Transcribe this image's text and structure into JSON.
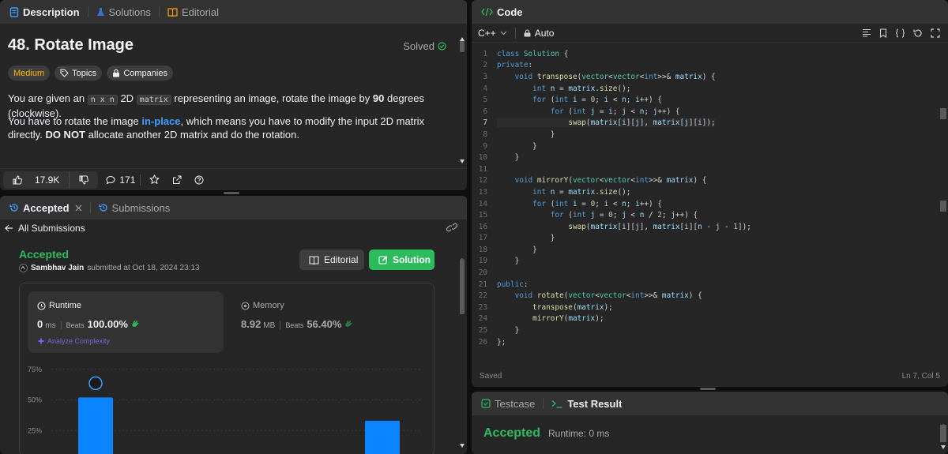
{
  "description_panel": {
    "tabs": [
      {
        "label": "Description",
        "icon": "document-icon"
      },
      {
        "label": "Solutions",
        "icon": "flask-icon"
      },
      {
        "label": "Editorial",
        "icon": "book-icon"
      }
    ],
    "title": "48. Rotate Image",
    "solved_label": "Solved",
    "tags": [
      {
        "label": "Medium"
      },
      {
        "label": "Topics",
        "icon": "tag-icon"
      },
      {
        "label": "Companies",
        "icon": "lock-icon"
      }
    ],
    "para1": {
      "before": "You are given an ",
      "code1": "n x n",
      "mid": " 2D ",
      "code2": "matrix",
      "after": " representing an image, rotate the image by ",
      "bold": "90",
      "end": " degrees (clockwise)."
    },
    "para2": {
      "before": "You have to rotate the image ",
      "link": "in-place",
      "mid": ", which means you have to modify the input 2D matrix directly. ",
      "bold": "DO NOT",
      "after": " allocate another 2D matrix and do the rotation."
    },
    "likes": "17.9K",
    "comments": "171"
  },
  "submissions_panel": {
    "tabs": [
      {
        "label": "Accepted",
        "icon": "history-icon"
      },
      {
        "label": "Submissions",
        "icon": "history-icon"
      }
    ],
    "back_label": "All Submissions",
    "status": "Accepted",
    "submitter_name": "Sambhav Jain",
    "submitted_text": "submitted at Oct 18, 2024 23:13",
    "editorial_button": "Editorial",
    "solution_button": "Solution",
    "runtime": {
      "label": "Runtime",
      "value": "0",
      "unit": "ms",
      "beats_label": "Beats",
      "beats_value": "100.00%",
      "analyze_label": "Analyze Complexity"
    },
    "memory": {
      "label": "Memory",
      "value": "8.92",
      "unit": "MB",
      "beats_label": "Beats",
      "beats_value": "56.40%"
    },
    "chart_data": {
      "type": "bar",
      "ylim": [
        0,
        80
      ],
      "y_ticks": [
        "75%",
        "50%",
        "25%"
      ],
      "y_tick_values": [
        75,
        50,
        25
      ],
      "bars": [
        {
          "value": 52,
          "highlighted": true
        },
        {
          "value": 33,
          "highlighted": false
        }
      ]
    }
  },
  "code_panel": {
    "tab_label": "Code",
    "language": "C++",
    "autocomplete": "Auto",
    "status_saved": "Saved",
    "cursor_pos": "Ln 7, Col 5",
    "current_line": 7,
    "lines": [
      "class Solution {",
      "private:",
      "    void transpose(vector<vector<int>>& matrix) {",
      "        int n = matrix.size();",
      "        for (int i = 0; i < n; i++) {",
      "            for (int j = i; j < n; j++) {",
      "                swap(matrix[i][j], matrix[j][i]);",
      "            }",
      "        }",
      "    }",
      "",
      "    void mirrorY(vector<vector<int>>& matrix) {",
      "        int n = matrix.size();",
      "        for (int i = 0; i < n; i++) {",
      "            for (int j = 0; j < n / 2; j++) {",
      "                swap(matrix[i][j], matrix[i][n - j - 1]);",
      "            }",
      "        }",
      "    }",
      "",
      "public:",
      "    void rotate(vector<vector<int>>& matrix) {",
      "        transpose(matrix);",
      "        mirrorY(matrix);",
      "    }",
      "};"
    ]
  },
  "result_panel": {
    "tabs": [
      {
        "label": "Testcase",
        "icon": "checkbox-icon"
      },
      {
        "label": "Test Result",
        "icon": "terminal-icon"
      }
    ],
    "status": "Accepted",
    "runtime_text": "Runtime: 0 ms"
  },
  "colors": {
    "accent_green": "#2cbb5d",
    "medium_yellow": "#ffb800",
    "link_blue": "#3b9eff",
    "bar_blue": "#0a84ff"
  }
}
